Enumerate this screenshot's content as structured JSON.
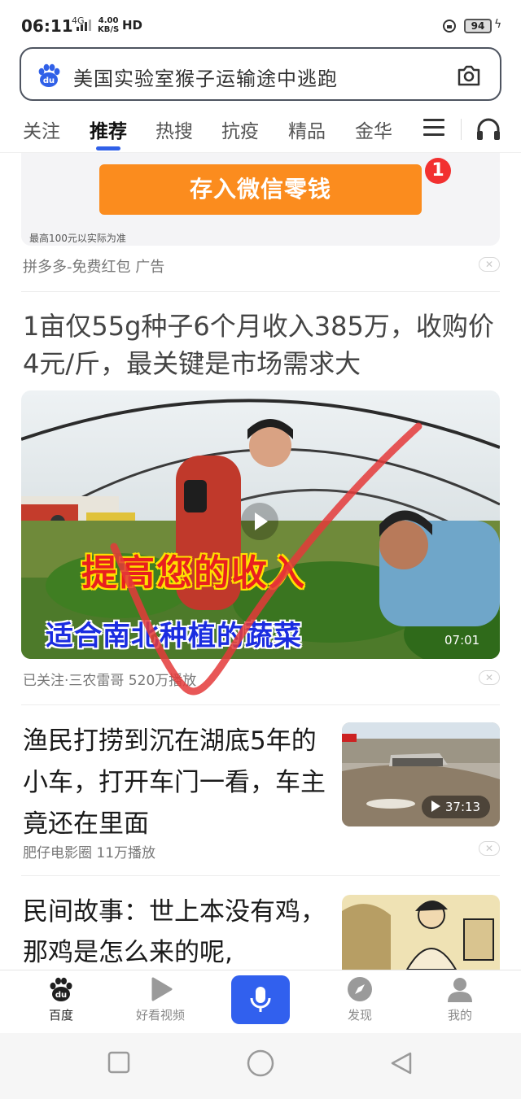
{
  "status_bar": {
    "time": "06:11",
    "network": "4G",
    "speed_value": "4.00",
    "speed_unit": "KB/S",
    "hd": "HD",
    "battery": "94"
  },
  "search": {
    "query": "美国实验室猴子运输途中逃跑"
  },
  "tabs": [
    "关注",
    "推荐",
    "热搜",
    "抗疫",
    "精品",
    "金华"
  ],
  "active_tab": "推荐",
  "ad": {
    "button_label": "存入微信零钱",
    "badge": "1",
    "note": "最高100元以实际为准",
    "source": "拼多多-免费红包  广告"
  },
  "feed": [
    {
      "title": "1亩仅55g种子6个月收入385万，收购价4元/斤，最关键是市场需求大",
      "caption_main": "提高您的收入",
      "caption_sub": "适合南北种植的蔬菜",
      "duration": "07:01",
      "meta": "已关注·三农雷哥  520万播放"
    },
    {
      "title": "渔民打捞到沉在湖底5年的小车，打开车门一看，车主竟还在里面",
      "duration": "37:13",
      "meta": "肥仔电影圈  11万播放"
    },
    {
      "title": "民间故事：世上本没有鸡，那鸡是怎么来的呢,"
    }
  ],
  "bottom_nav": {
    "home": "百度",
    "video": "好看视频",
    "discover": "发现",
    "profile": "我的"
  },
  "colors": {
    "accent": "#3160ee",
    "ad_button": "#fb8c1e",
    "badge": "#f23030",
    "annotation": "#e43a3a"
  }
}
